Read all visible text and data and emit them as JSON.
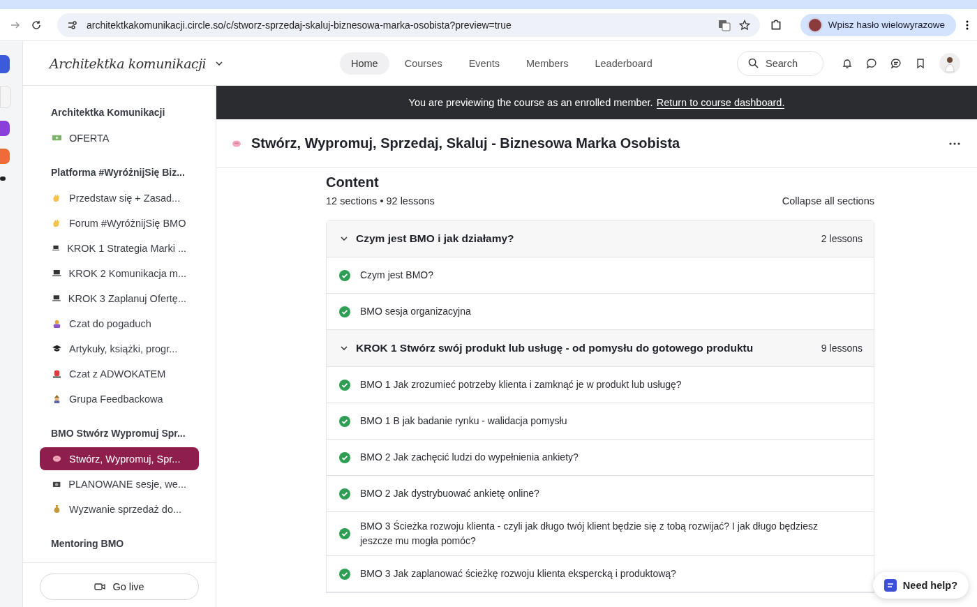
{
  "browser": {
    "url": "architektkakomunikacji.circle.so/c/stworz-sprzedaj-skaluj-biznesowa-marka-osobista?preview=true",
    "profile_prompt": "Wpisz hasło wielowyrazowe"
  },
  "header": {
    "logo": "Architektka komunikacji",
    "nav": [
      {
        "label": "Home",
        "selected": true
      },
      {
        "label": "Courses",
        "selected": false
      },
      {
        "label": "Events",
        "selected": false
      },
      {
        "label": "Members",
        "selected": false
      },
      {
        "label": "Leaderboard",
        "selected": false
      }
    ],
    "search": {
      "placeholder": "Search"
    }
  },
  "sidebar": {
    "groups": [
      {
        "title": "Architektka Komunikacji",
        "items": [
          {
            "label": "OFERTA",
            "selected": false
          }
        ]
      },
      {
        "title": "Platforma #WyróżnijSię Biz...",
        "items": [
          {
            "label": "Przedstaw się + Zasad...",
            "selected": false
          },
          {
            "label": "Forum #WyróżnijSię BMO",
            "selected": false
          },
          {
            "label": "KROK 1 Strategia Marki ...",
            "selected": false
          },
          {
            "label": "KROK 2 Komunikacja m...",
            "selected": false
          },
          {
            "label": "KROK 3 Zaplanuj Ofertę...",
            "selected": false
          },
          {
            "label": "Czat do pogaduch",
            "selected": false
          },
          {
            "label": "Artykuły, książki, progr...",
            "selected": false
          },
          {
            "label": "Czat z ADWOKATEM",
            "selected": false
          },
          {
            "label": "Grupa Feedbackowa",
            "selected": false
          }
        ]
      },
      {
        "title": "BMO Stwórz Wypromuj Spr...",
        "items": [
          {
            "label": "Stwórz, Wypromuj, Spr...",
            "selected": true
          },
          {
            "label": "PLANOWANE sesje, we...",
            "selected": false
          },
          {
            "label": "Wyzwanie sprzedaż do...",
            "selected": false
          }
        ]
      },
      {
        "title": "Mentoring BMO"
      }
    ],
    "go_live": "Go live"
  },
  "banner": {
    "text": "You are previewing the course as an enrolled member.",
    "link": "Return to course dashboard."
  },
  "course": {
    "title": "Stwórz, Wypromuj, Sprzedaj, Skaluj - Biznesowa Marka Osobista"
  },
  "content": {
    "heading": "Content",
    "summary": "12 sections • 92 lessons",
    "collapse": "Collapse all sections",
    "sections": [
      {
        "title": "Czym jest BMO i jak działamy?",
        "count": "2 lessons",
        "expanded": true,
        "lessons": [
          {
            "title": "Czym jest BMO?",
            "completed": true
          },
          {
            "title": "BMO sesja organizacyjna",
            "completed": true
          }
        ]
      },
      {
        "title": "KROK 1 Stwórz swój produkt lub usługę - od pomysłu do gotowego produktu",
        "count": "9 lessons",
        "expanded": true,
        "lessons": [
          {
            "title": "BMO 1 Jak zrozumieć potrzeby klienta i zamknąć je w produkt lub usługę?",
            "completed": true
          },
          {
            "title": "BMO 1 B jak badanie rynku - walidacja pomysłu",
            "completed": true
          },
          {
            "title": "BMO 2 Jak zachęcić ludzi do wypełnienia ankiety?",
            "completed": true
          },
          {
            "title": "BMO 2 Jak dystrybuować ankietę online?",
            "completed": true
          },
          {
            "title": "BMO 3 Ścieżka rozwoju klienta - czyli jak długo twój klient będzie się z tobą rozwijać? I jak długo będziesz jeszcze mu mogła pomóc?",
            "completed": true
          },
          {
            "title": "BMO 3 Jak zaplanować ścieżkę rozwoju klienta ekspercką i produktową?",
            "completed": true
          }
        ]
      }
    ]
  },
  "help": {
    "label": "Need help?"
  }
}
